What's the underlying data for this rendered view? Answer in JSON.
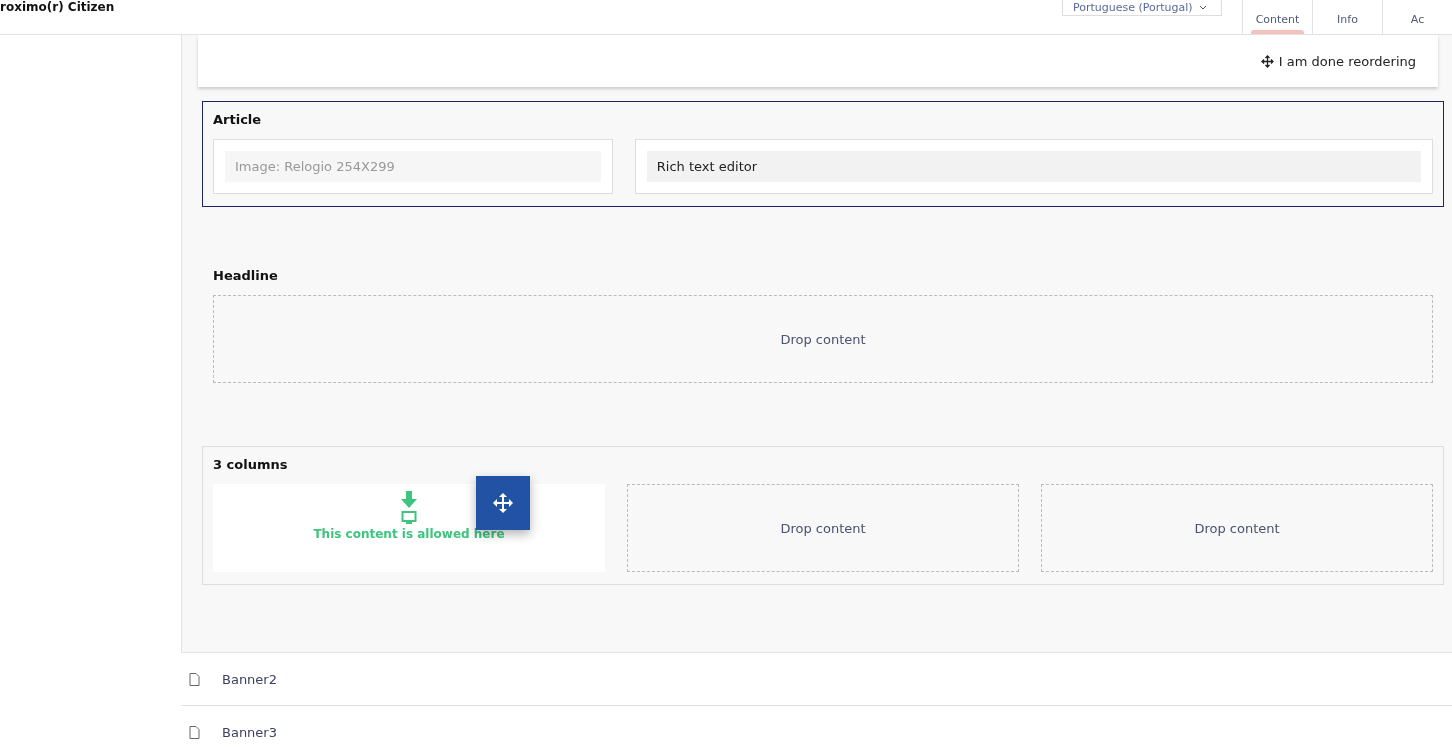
{
  "header": {
    "title": "roximo(r) Citizen",
    "language": "Portuguese (Portugal)",
    "tabs": [
      {
        "label": "Content",
        "selected": true
      },
      {
        "label": "Info",
        "selected": false
      },
      {
        "label": "Ac",
        "selected": false
      }
    ]
  },
  "toolbar": {
    "done_button": "I am done reordering"
  },
  "sections": [
    {
      "title": "Article",
      "highlighted": true,
      "kind": "fields",
      "cells": [
        {
          "kind": "image",
          "text": "Image: Relogio 254X299"
        },
        {
          "kind": "editor",
          "text": "Rich text editor"
        }
      ]
    },
    {
      "title": "Headline",
      "highlighted": false,
      "kind": "drops",
      "cells": [
        {
          "text": "Drop content",
          "dragging": false
        }
      ]
    },
    {
      "title": "3 columns",
      "highlighted": false,
      "kind": "drops",
      "framed": true,
      "cells": [
        {
          "dragging": true,
          "allowed": "This content is allowed here"
        },
        {
          "text": "Drop content",
          "dragging": false
        },
        {
          "text": "Drop content",
          "dragging": false
        }
      ]
    }
  ],
  "list": [
    {
      "name": "Banner2"
    },
    {
      "name": "Banner3"
    }
  ]
}
